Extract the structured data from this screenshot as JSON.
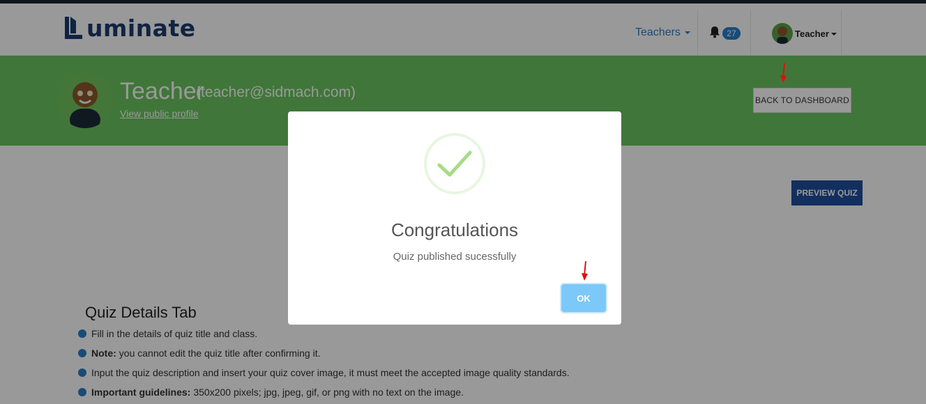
{
  "nav": {
    "logo_text": "uminate",
    "teachers_label": "Teachers",
    "notifications_count": "27",
    "user_label": "Teacher"
  },
  "profile": {
    "name": "Teacher",
    "email": "(teacher@sidmach.com)",
    "public_profile_link": "View public profile",
    "back_button": "BACK TO DASHBOARD"
  },
  "page": {
    "preview_button": "PREVIEW QUIZ",
    "tab_title": "Quiz Details Tab",
    "guidelines": [
      {
        "bold": "",
        "text": "Fill in the details of quiz title and class."
      },
      {
        "bold": "Note:",
        "text": "you cannot edit the quiz title after confirming it."
      },
      {
        "bold": "",
        "text": "Input the quiz description and insert your quiz cover image, it must meet the accepted image quality standards."
      },
      {
        "bold": "Important guidelines:",
        "text": "350x200 pixels; jpg, jpeg, gif, or png with no text on the image."
      }
    ]
  },
  "modal": {
    "title": "Congratulations",
    "message": "Quiz published sucessfully",
    "ok_button": "OK"
  },
  "colors": {
    "banner_green": "#6bc55f",
    "brand_blue": "#2a7dc9",
    "navy_button": "#1e4f9e",
    "success_check": "#a5dc86",
    "ok_button": "#7cc8f8",
    "annotation_arrow": "#e01010"
  },
  "icons": {
    "check": "success-check-icon",
    "bell": "bell-icon",
    "arrow": "red-arrow-annotation"
  }
}
